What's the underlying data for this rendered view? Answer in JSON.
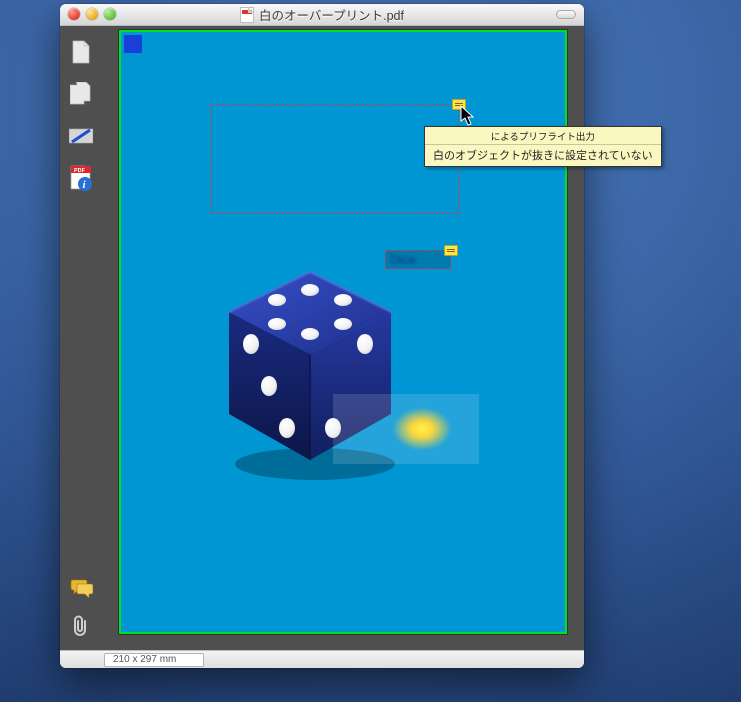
{
  "window": {
    "title": "白のオーバープリント.pdf"
  },
  "sidebar": {
    "items": [
      {
        "name": "page-blank-icon"
      },
      {
        "name": "page-multi-icon"
      },
      {
        "name": "tool-marker-icon"
      },
      {
        "name": "pdf-info-icon"
      }
    ],
    "bottom": [
      {
        "name": "comments-icon"
      },
      {
        "name": "attachment-icon"
      }
    ]
  },
  "page": {
    "dice_label": "Dice"
  },
  "tooltip": {
    "header": "によるプリフライト出力",
    "body": "白のオブジェクトが抜きに設定されていない"
  },
  "status": {
    "dimensions": "210 x 297 mm"
  }
}
